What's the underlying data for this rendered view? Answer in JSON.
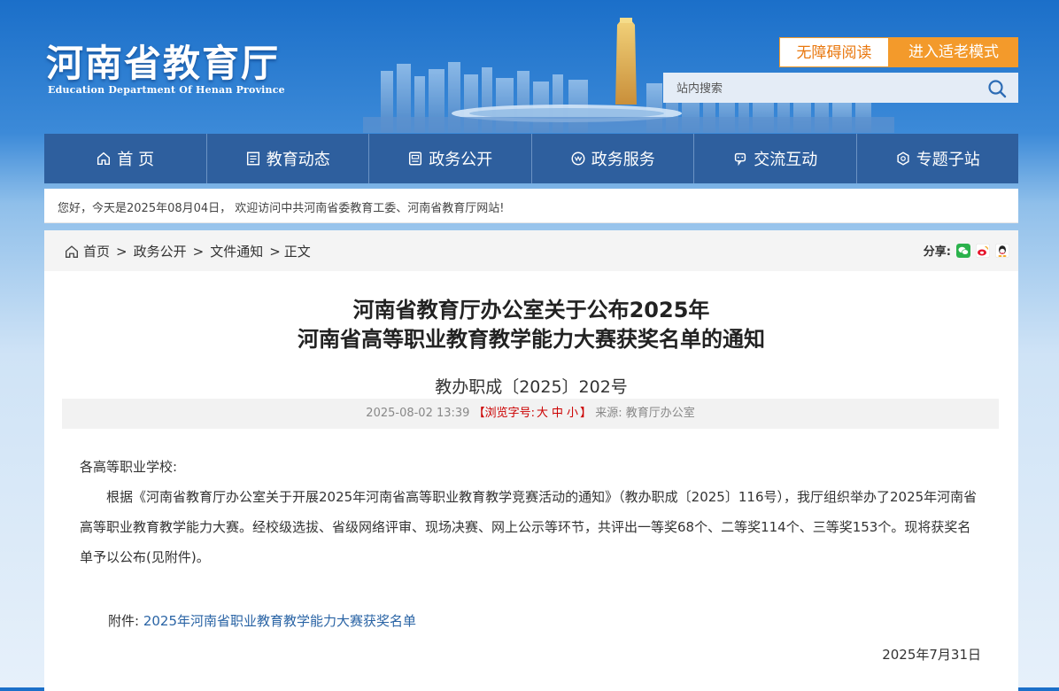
{
  "header": {
    "logo_cn": "河南省教育厅",
    "logo_en": "Education Department Of Henan Province",
    "accessibility_label": "无障碍阅读",
    "elder_mode_label": "进入适老模式",
    "search_placeholder": "站内搜索"
  },
  "nav": [
    {
      "label": "首 页",
      "icon": "home-icon"
    },
    {
      "label": "教育动态",
      "icon": "news-icon"
    },
    {
      "label": "政务公开",
      "icon": "document-icon"
    },
    {
      "label": "政务服务",
      "icon": "service-icon"
    },
    {
      "label": "交流互动",
      "icon": "interaction-icon"
    },
    {
      "label": "专题子站",
      "icon": "subsite-icon"
    }
  ],
  "welcome": "您好，今天是2025年08月04日， 欢迎访问中共河南省委教育工委、河南省教育厅网站!",
  "breadcrumb": {
    "items": [
      "首页",
      "政务公开",
      "文件通知"
    ],
    "current": "正文"
  },
  "share": {
    "label": "分享:",
    "icons": [
      "wechat-icon",
      "weibo-icon",
      "qq-icon"
    ]
  },
  "article": {
    "title_line1": "河南省教育厅办公室关于公布2025年",
    "title_line2": "河南省高等职业教育教学能力大赛获奖名单的通知",
    "doc_number": "教办职成〔2025〕202号",
    "datetime": "2025-08-02 13:39",
    "font_size_prefix": "【浏览字号:",
    "font_sizes": [
      "大",
      "中",
      "小"
    ],
    "font_size_suffix": "】",
    "source": "来源:  教育厅办公室",
    "salutation": "各高等职业学校:",
    "paragraph": "根据《河南省教育厅办公室关于开展2025年河南省高等职业教育教学竞赛活动的通知》（教办职成〔2025〕116号），我厅组织举办了2025年河南省高等职业教育教学能力大赛。经校级选拔、省级网络评审、现场决赛、网上公示等环节，共评出一等奖68个、二等奖114个、三等奖153个。现将获奖名单予以公布(见附件)。",
    "attachment_label": "附件:",
    "attachment_link": "2025年河南省职业教育教学能力大赛获奖名单",
    "date": "2025年7月31日"
  },
  "colors": {
    "nav_bg": "#2e5f9e",
    "accent_orange": "#f39a2b",
    "link_blue": "#2a64a5",
    "font_size_red": "#cc0000"
  }
}
